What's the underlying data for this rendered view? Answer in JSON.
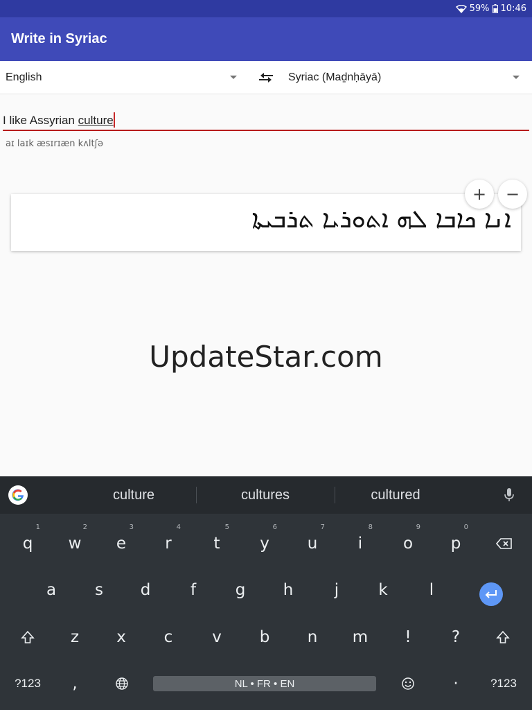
{
  "status_bar": {
    "battery": "59%",
    "time": "10:46"
  },
  "app_bar": {
    "title": "Write in Syriac"
  },
  "languages": {
    "source": "English",
    "target": "Syriac (Maḏnḥāyā)"
  },
  "input": {
    "text_plain": "I like Assyrian ",
    "text_composing": "culture",
    "phonetic": "aɪ laɪk æsɪrɪæn kʌltʃə"
  },
  "output": {
    "syriac_text": "ܐܢܐ ܟܐܒܐ ܠܗ ܐܬܘܪܝܐ ܬܪܒܝܬܐ"
  },
  "zoom": {
    "in": "+",
    "out": "−"
  },
  "watermark": "UpdateStar.com",
  "keyboard": {
    "suggestions": [
      "culture",
      "cultures",
      "cultured"
    ],
    "row1": [
      {
        "k": "q",
        "h": "1"
      },
      {
        "k": "w",
        "h": "2"
      },
      {
        "k": "e",
        "h": "3"
      },
      {
        "k": "r",
        "h": "4"
      },
      {
        "k": "t",
        "h": "5"
      },
      {
        "k": "y",
        "h": "6"
      },
      {
        "k": "u",
        "h": "7"
      },
      {
        "k": "i",
        "h": "8"
      },
      {
        "k": "o",
        "h": "9"
      },
      {
        "k": "p",
        "h": "0"
      }
    ],
    "row2": [
      "a",
      "s",
      "d",
      "f",
      "g",
      "h",
      "j",
      "k",
      "l"
    ],
    "row3": [
      "z",
      "x",
      "c",
      "v",
      "b",
      "n",
      "m",
      "!",
      "?"
    ],
    "mode_left": "?123",
    "mode_right": "?123",
    "comma": ",",
    "period": "·",
    "space_label": "NL • FR • EN"
  }
}
